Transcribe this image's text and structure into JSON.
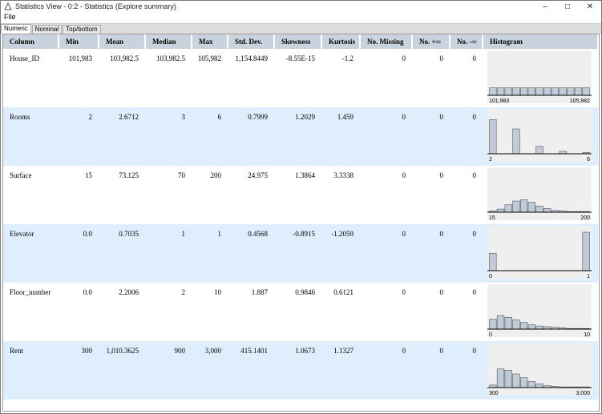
{
  "window": {
    "title": "Statistics View - 0:2 - Statistics (Explore summary)"
  },
  "menu": {
    "file": "File"
  },
  "tabs": [
    "Numeric",
    "Nominal",
    "Top/bottom"
  ],
  "columns": [
    "Column",
    "Min",
    "Mean",
    "Median",
    "Max",
    "Std. Dev.",
    "Skewness",
    "Kurtosis",
    "No. Missing",
    "No. +∞",
    "No. -∞",
    "Histogram"
  ],
  "rows": [
    {
      "name": "House_ID",
      "min": "101,983",
      "mean": "103,982.5",
      "median": "103,982.5",
      "max": "105,982",
      "std": "1,154.8449",
      "skew": "-8.55E-15",
      "kurt": "-1.2",
      "missing": "0",
      "pinf": "0",
      "ninf": "0",
      "hist": {
        "min_label": "101,983",
        "max_label": "105,982",
        "bins": [
          0.12,
          0.12,
          0.12,
          0.12,
          0.12,
          0.12,
          0.12,
          0.12,
          0.12,
          0.12,
          0.12,
          0.12,
          0.12
        ]
      }
    },
    {
      "name": "Rooms",
      "min": "2",
      "mean": "2.6712",
      "median": "3",
      "max": "6",
      "std": "0.7999",
      "skew": "1.2029",
      "kurt": "1.459",
      "missing": "0",
      "pinf": "0",
      "ninf": "0",
      "hist": {
        "min_label": "2",
        "max_label": "6",
        "bins": [
          0.55,
          0,
          0,
          0.4,
          0,
          0,
          0.12,
          0,
          0,
          0.04,
          0,
          0,
          0.02
        ]
      }
    },
    {
      "name": "Surface",
      "min": "15",
      "mean": "73.125",
      "median": "70",
      "max": "200",
      "std": "24.975",
      "skew": "1.3864",
      "kurt": "3.3338",
      "missing": "0",
      "pinf": "0",
      "ninf": "0",
      "hist": {
        "min_label": "15",
        "max_label": "200",
        "bins": [
          0.02,
          0.05,
          0.12,
          0.18,
          0.2,
          0.16,
          0.1,
          0.06,
          0.03,
          0.02,
          0.01,
          0.01,
          0.01
        ]
      }
    },
    {
      "name": "Elevator",
      "min": "0.0",
      "mean": "0.7035",
      "median": "1",
      "max": "1",
      "std": "0.4568",
      "skew": "-0.8915",
      "kurt": "-1.2059",
      "missing": "0",
      "pinf": "0",
      "ninf": "0",
      "hist": {
        "min_label": "0",
        "max_label": "1",
        "bins": [
          0.28,
          0,
          0,
          0,
          0,
          0,
          0,
          0,
          0,
          0,
          0,
          0,
          0.62
        ]
      }
    },
    {
      "name": "Floor_number",
      "min": "0.0",
      "mean": "2.2006",
      "median": "2",
      "max": "10",
      "std": "1.887",
      "skew": "0.9846",
      "kurt": "0.6121",
      "missing": "0",
      "pinf": "0",
      "ninf": "0",
      "hist": {
        "min_label": "0",
        "max_label": "10",
        "bins": [
          0.16,
          0.22,
          0.19,
          0.15,
          0.11,
          0.07,
          0.05,
          0.04,
          0.03,
          0.02,
          0.01,
          0.01,
          0.01
        ]
      }
    },
    {
      "name": "Rent",
      "min": "300",
      "mean": "1,010.3625",
      "median": "900",
      "max": "3,000",
      "std": "415.1401",
      "skew": "1.0673",
      "kurt": "1.1327",
      "missing": "0",
      "pinf": "0",
      "ninf": "0",
      "hist": {
        "min_label": "300",
        "max_label": "3,000",
        "bins": [
          0.04,
          0.3,
          0.28,
          0.22,
          0.16,
          0.1,
          0.06,
          0.03,
          0.02,
          0.01,
          0.01,
          0.01,
          0.01
        ]
      }
    }
  ],
  "colors": {
    "header": "#c9d3de",
    "alt_row": "#deeefc",
    "bar": "#bfcbd8"
  }
}
